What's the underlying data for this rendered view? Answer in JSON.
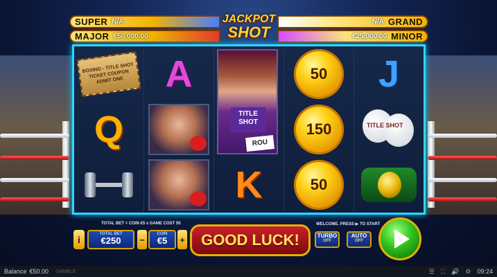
{
  "jackpots": {
    "super": {
      "name": "SUPER",
      "value": "N/A"
    },
    "major": {
      "name": "MAJOR",
      "value": "€50,000.00"
    },
    "grand": {
      "name": "GRAND",
      "value": "N/A"
    },
    "minor": {
      "name": "MINOR",
      "value": "€25,000.00"
    },
    "logo_line1": "JACKPOT",
    "logo_line2": "SHOT"
  },
  "reels": {
    "ticket": [
      "BOXING - TITLE SHOT",
      "TICKET COUPON",
      "ADMIT ONE"
    ],
    "girl_shirt": "TITLE SHOT",
    "girl_card": "ROU",
    "letter_a": "A",
    "letter_q": "Q",
    "letter_k": "K",
    "letter_j": "J",
    "coin_top": "50",
    "coin_mid": "150",
    "coin_bot": "50",
    "gloves_label": "TITLE SHOT"
  },
  "controls": {
    "total_bet_formula": "TOTAL BET = COIN €5 x GAME COST 50",
    "total_bet_label": "TOTAL BET",
    "total_bet_value": "€250",
    "coin_label": "COIN",
    "coin_value": "€5",
    "minus": "−",
    "plus": "+",
    "info": "i",
    "message": "GOOD LUCK!",
    "welcome": "WELCOME. PRESS ▶ TO START",
    "turbo_label": "TURBO",
    "turbo_state": "OFF",
    "auto_label": "AUTO",
    "auto_state": "OFF"
  },
  "status": {
    "balance_label": "Balance",
    "balance_value": "€50.00",
    "brand": "GAMBLE",
    "time": "09:24"
  },
  "colors": {
    "reel_border": "#2fd6ff",
    "message_bg": "#c8202a",
    "spin_button": "#2fc21a",
    "gold": "#e6b000"
  }
}
